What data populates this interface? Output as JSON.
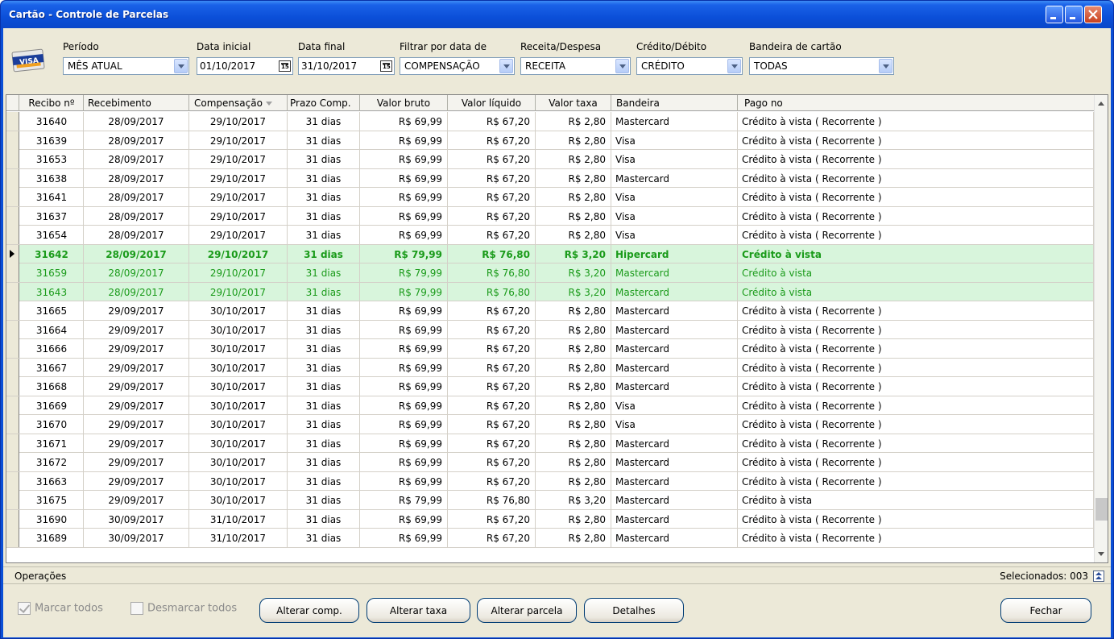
{
  "window": {
    "title": "Cartão - Controle de Parcelas"
  },
  "filters": {
    "periodo": {
      "label": "Período",
      "value": "MÊS ATUAL"
    },
    "data_inicial": {
      "label": "Data inicial",
      "value": "01/10/2017"
    },
    "data_final": {
      "label": "Data final",
      "value": "31/10/2017"
    },
    "filtrar_por": {
      "label": "Filtrar por data de",
      "value": "COMPENSAÇÃO"
    },
    "receita_despesa": {
      "label": "Receita/Despesa",
      "value": "RECEITA"
    },
    "credito_debito": {
      "label": "Crédito/Débito",
      "value": "CRÉDITO"
    },
    "bandeira": {
      "label": "Bandeira de cartão",
      "value": "TODAS"
    },
    "icon": "visa-card-icon"
  },
  "grid": {
    "columns": [
      "Recibo nº",
      "Recebimento",
      "Compensação",
      "Prazo Comp.",
      "Valor bruto",
      "Valor líquido",
      "Valor taxa",
      "Bandeira",
      "Pago no"
    ],
    "rows": [
      {
        "recibo": "31640",
        "receb": "28/09/2017",
        "comp": "29/10/2017",
        "prazo": "31 dias",
        "bruto": "R$ 69,99",
        "liquido": "R$ 67,20",
        "taxa": "R$ 2,80",
        "bandeira": "Mastercard",
        "pago": "Crédito à vista ( Recorrente )",
        "hl": false
      },
      {
        "recibo": "31639",
        "receb": "28/09/2017",
        "comp": "29/10/2017",
        "prazo": "31 dias",
        "bruto": "R$ 69,99",
        "liquido": "R$ 67,20",
        "taxa": "R$ 2,80",
        "bandeira": "Visa",
        "pago": "Crédito à vista ( Recorrente )",
        "hl": false
      },
      {
        "recibo": "31653",
        "receb": "28/09/2017",
        "comp": "29/10/2017",
        "prazo": "31 dias",
        "bruto": "R$ 69,99",
        "liquido": "R$ 67,20",
        "taxa": "R$ 2,80",
        "bandeira": "Visa",
        "pago": "Crédito à vista ( Recorrente )",
        "hl": false
      },
      {
        "recibo": "31638",
        "receb": "28/09/2017",
        "comp": "29/10/2017",
        "prazo": "31 dias",
        "bruto": "R$ 69,99",
        "liquido": "R$ 67,20",
        "taxa": "R$ 2,80",
        "bandeira": "Mastercard",
        "pago": "Crédito à vista ( Recorrente )",
        "hl": false
      },
      {
        "recibo": "31641",
        "receb": "28/09/2017",
        "comp": "29/10/2017",
        "prazo": "31 dias",
        "bruto": "R$ 69,99",
        "liquido": "R$ 67,20",
        "taxa": "R$ 2,80",
        "bandeira": "Visa",
        "pago": "Crédito à vista ( Recorrente )",
        "hl": false
      },
      {
        "recibo": "31637",
        "receb": "28/09/2017",
        "comp": "29/10/2017",
        "prazo": "31 dias",
        "bruto": "R$ 69,99",
        "liquido": "R$ 67,20",
        "taxa": "R$ 2,80",
        "bandeira": "Visa",
        "pago": "Crédito à vista ( Recorrente )",
        "hl": false
      },
      {
        "recibo": "31654",
        "receb": "28/09/2017",
        "comp": "29/10/2017",
        "prazo": "31 dias",
        "bruto": "R$ 69,99",
        "liquido": "R$ 67,20",
        "taxa": "R$ 2,80",
        "bandeira": "Visa",
        "pago": "Crédito à vista ( Recorrente )",
        "hl": false
      },
      {
        "recibo": "31642",
        "receb": "28/09/2017",
        "comp": "29/10/2017",
        "prazo": "31 dias",
        "bruto": "R$ 79,99",
        "liquido": "R$ 76,80",
        "taxa": "R$ 3,20",
        "bandeira": "Hipercard",
        "pago": "Crédito à vista",
        "hl": true,
        "bold": true,
        "active": true
      },
      {
        "recibo": "31659",
        "receb": "28/09/2017",
        "comp": "29/10/2017",
        "prazo": "31 dias",
        "bruto": "R$ 79,99",
        "liquido": "R$ 76,80",
        "taxa": "R$ 3,20",
        "bandeira": "Mastercard",
        "pago": "Crédito à vista",
        "hl": true
      },
      {
        "recibo": "31643",
        "receb": "28/09/2017",
        "comp": "29/10/2017",
        "prazo": "31 dias",
        "bruto": "R$ 79,99",
        "liquido": "R$ 76,80",
        "taxa": "R$ 3,20",
        "bandeira": "Mastercard",
        "pago": "Crédito à vista",
        "hl": true
      },
      {
        "recibo": "31665",
        "receb": "29/09/2017",
        "comp": "30/10/2017",
        "prazo": "31 dias",
        "bruto": "R$ 69,99",
        "liquido": "R$ 67,20",
        "taxa": "R$ 2,80",
        "bandeira": "Mastercard",
        "pago": "Crédito à vista ( Recorrente )",
        "hl": false
      },
      {
        "recibo": "31664",
        "receb": "29/09/2017",
        "comp": "30/10/2017",
        "prazo": "31 dias",
        "bruto": "R$ 69,99",
        "liquido": "R$ 67,20",
        "taxa": "R$ 2,80",
        "bandeira": "Mastercard",
        "pago": "Crédito à vista ( Recorrente )",
        "hl": false
      },
      {
        "recibo": "31666",
        "receb": "29/09/2017",
        "comp": "30/10/2017",
        "prazo": "31 dias",
        "bruto": "R$ 69,99",
        "liquido": "R$ 67,20",
        "taxa": "R$ 2,80",
        "bandeira": "Mastercard",
        "pago": "Crédito à vista ( Recorrente )",
        "hl": false
      },
      {
        "recibo": "31667",
        "receb": "29/09/2017",
        "comp": "30/10/2017",
        "prazo": "31 dias",
        "bruto": "R$ 69,99",
        "liquido": "R$ 67,20",
        "taxa": "R$ 2,80",
        "bandeira": "Mastercard",
        "pago": "Crédito à vista ( Recorrente )",
        "hl": false
      },
      {
        "recibo": "31668",
        "receb": "29/09/2017",
        "comp": "30/10/2017",
        "prazo": "31 dias",
        "bruto": "R$ 69,99",
        "liquido": "R$ 67,20",
        "taxa": "R$ 2,80",
        "bandeira": "Mastercard",
        "pago": "Crédito à vista ( Recorrente )",
        "hl": false
      },
      {
        "recibo": "31669",
        "receb": "29/09/2017",
        "comp": "30/10/2017",
        "prazo": "31 dias",
        "bruto": "R$ 69,99",
        "liquido": "R$ 67,20",
        "taxa": "R$ 2,80",
        "bandeira": "Visa",
        "pago": "Crédito à vista ( Recorrente )",
        "hl": false
      },
      {
        "recibo": "31670",
        "receb": "29/09/2017",
        "comp": "30/10/2017",
        "prazo": "31 dias",
        "bruto": "R$ 69,99",
        "liquido": "R$ 67,20",
        "taxa": "R$ 2,80",
        "bandeira": "Visa",
        "pago": "Crédito à vista ( Recorrente )",
        "hl": false
      },
      {
        "recibo": "31671",
        "receb": "29/09/2017",
        "comp": "30/10/2017",
        "prazo": "31 dias",
        "bruto": "R$ 69,99",
        "liquido": "R$ 67,20",
        "taxa": "R$ 2,80",
        "bandeira": "Mastercard",
        "pago": "Crédito à vista ( Recorrente )",
        "hl": false
      },
      {
        "recibo": "31672",
        "receb": "29/09/2017",
        "comp": "30/10/2017",
        "prazo": "31 dias",
        "bruto": "R$ 69,99",
        "liquido": "R$ 67,20",
        "taxa": "R$ 2,80",
        "bandeira": "Mastercard",
        "pago": "Crédito à vista ( Recorrente )",
        "hl": false
      },
      {
        "recibo": "31663",
        "receb": "29/09/2017",
        "comp": "30/10/2017",
        "prazo": "31 dias",
        "bruto": "R$ 69,99",
        "liquido": "R$ 67,20",
        "taxa": "R$ 2,80",
        "bandeira": "Mastercard",
        "pago": "Crédito à vista ( Recorrente )",
        "hl": false
      },
      {
        "recibo": "31675",
        "receb": "29/09/2017",
        "comp": "30/10/2017",
        "prazo": "31 dias",
        "bruto": "R$ 79,99",
        "liquido": "R$ 76,80",
        "taxa": "R$ 3,20",
        "bandeira": "Mastercard",
        "pago": "Crédito à vista",
        "hl": false
      },
      {
        "recibo": "31690",
        "receb": "30/09/2017",
        "comp": "31/10/2017",
        "prazo": "31 dias",
        "bruto": "R$ 69,99",
        "liquido": "R$ 67,20",
        "taxa": "R$ 2,80",
        "bandeira": "Mastercard",
        "pago": "Crédito à vista ( Recorrente )",
        "hl": false
      },
      {
        "recibo": "31689",
        "receb": "30/09/2017",
        "comp": "31/10/2017",
        "prazo": "31 dias",
        "bruto": "R$ 69,99",
        "liquido": "R$ 67,20",
        "taxa": "R$ 2,80",
        "bandeira": "Mastercard",
        "pago": "Crédito à vista ( Recorrente )",
        "hl": false
      }
    ]
  },
  "ops": {
    "label": "Operações",
    "selected": "Selecionados: 003"
  },
  "bottom": {
    "marcar_todos": "Marcar todos",
    "desmarcar_todos": "Desmarcar todos",
    "alterar_comp": "Alterar comp.",
    "alterar_taxa": "Alterar taxa",
    "alterar_parcela": "Alterar parcela",
    "detalhes": "Detalhes",
    "fechar": "Fechar"
  },
  "colors": {
    "highlight_bg": "#d8f5dc",
    "highlight_text": "#1a9b1a",
    "titlebar": "#0b4fd8"
  }
}
